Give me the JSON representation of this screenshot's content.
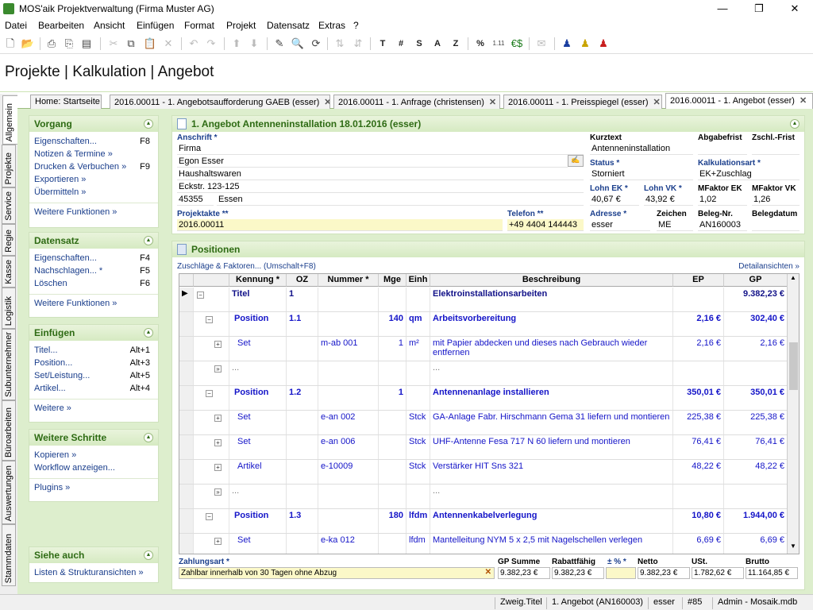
{
  "window": {
    "title": "MOS'aik Projektverwaltung (Firma Muster AG)"
  },
  "menu": [
    "Datei",
    "Bearbeiten",
    "Ansicht",
    "Einfügen",
    "Format",
    "Projekt",
    "Datensatz",
    "Extras",
    "?"
  ],
  "toolbar": {
    "text_buttons": [
      "T",
      "#",
      "S",
      "A",
      "Z",
      "%"
    ]
  },
  "breadcrumb": "Projekte | Kalkulation | Angebot",
  "doc_tabs": [
    {
      "label": "Home: Startseite"
    },
    {
      "label": "2016.00011 - 1. Angebotsaufforderung GAEB (esser)"
    },
    {
      "label": "2016.00011 - 1. Anfrage (christensen)"
    },
    {
      "label": "2016.00011 - 1. Preisspiegel (esser)"
    },
    {
      "label": "2016.00011 - 1. Angebot (esser)"
    }
  ],
  "side_tabs": [
    "Allgemein",
    "Projekte",
    "Service",
    "Regie",
    "Kasse",
    "Logistik",
    "Subunternehmer",
    "Büroarbeiten",
    "Auswertungen",
    "Stammdaten"
  ],
  "left": {
    "vorgang": {
      "title": "Vorgang",
      "items": [
        {
          "label": "Eigenschaften...",
          "key": "F8"
        },
        {
          "label": "Notizen & Termine »",
          "key": ""
        },
        {
          "label": "Drucken & Verbuchen »",
          "key": "F9"
        },
        {
          "label": "Exportieren »",
          "key": ""
        },
        {
          "label": "Übermitteln »",
          "key": ""
        }
      ],
      "more": "Weitere Funktionen »"
    },
    "datensatz": {
      "title": "Datensatz",
      "items": [
        {
          "label": "Eigenschaften...",
          "key": "F4"
        },
        {
          "label": "Nachschlagen... *",
          "key": "F5"
        },
        {
          "label": "Löschen",
          "key": "F6"
        }
      ],
      "more": "Weitere Funktionen »"
    },
    "einfuegen": {
      "title": "Einfügen",
      "items": [
        {
          "label": "Titel...",
          "key": "Alt+1"
        },
        {
          "label": "Position...",
          "key": "Alt+3"
        },
        {
          "label": "Set/Leistung...",
          "key": "Alt+5"
        },
        {
          "label": "Artikel...",
          "key": "Alt+4"
        }
      ],
      "more": "Weitere »"
    },
    "schritte": {
      "title": "Weitere Schritte",
      "items": [
        {
          "label": "Kopieren »",
          "key": ""
        },
        {
          "label": "Workflow anzeigen...",
          "key": ""
        }
      ],
      "more": "Plugins »"
    },
    "siehe": {
      "title": "Siehe auch",
      "items": [
        {
          "label": "Listen & Strukturansichten »",
          "key": ""
        }
      ]
    }
  },
  "header": {
    "title": "1. Angebot Antenneninstallation 18.01.2016 (esser)",
    "anschrift_label": "Anschrift *",
    "anschrift": [
      "Firma",
      "Egon Esser",
      "Haushaltswaren",
      "Eckstr. 123-125"
    ],
    "plz": "45355",
    "ort": "Essen",
    "projektakte_label": "Projektakte **",
    "projektakte": "2016.00011",
    "telefon_label": "Telefon **",
    "telefon": "+49 4404 144443",
    "kurztext_label": "Kurztext",
    "kurztext": "Antenneninstallation",
    "abgabefrist_label": "Abgabefrist",
    "zschl_label": "Zschl.-Frist",
    "status_label": "Status *",
    "status": "Storniert",
    "kalkart_label": "Kalkulationsart *",
    "kalkart": "EK+Zuschlag",
    "lohn_ek_label": "Lohn EK *",
    "lohn_ek": "40,67 €",
    "lohn_vk_label": "Lohn VK *",
    "lohn_vk": "43,92 €",
    "mf_ek_label": "MFaktor EK",
    "mf_ek": "1,02",
    "mf_vk_label": "MFaktor VK",
    "mf_vk": "1,26",
    "adresse_label": "Adresse *",
    "adresse": "esser",
    "zeichen_label": "Zeichen",
    "zeichen": "ME",
    "belegnr_label": "Beleg-Nr.",
    "belegnr": "AN160003",
    "belegdatum_label": "Belegdatum"
  },
  "positions": {
    "title": "Positionen",
    "zuschlaege": "Zuschläge & Faktoren... (Umschalt+F8)",
    "detail": "Detailansichten »",
    "columns": [
      "Kennung *",
      "OZ",
      "Nummer *",
      "Mge",
      "Einh",
      "Beschreibung",
      "EP",
      "GP"
    ],
    "rows": [
      {
        "kennung": "Titel",
        "oz": "1",
        "nummer": "",
        "mge": "",
        "einh": "",
        "beschreibung": "Elektroinstallationsarbeiten",
        "ep": "",
        "gp": "9.382,23 €",
        "lvl": 0,
        "bold": true
      },
      {
        "kennung": "Position",
        "oz": "1.1",
        "nummer": "",
        "mge": "140",
        "einh": "qm",
        "beschreibung": "Arbeitsvorbereitung",
        "ep": "2,16 €",
        "gp": "302,40 €",
        "lvl": 1,
        "bold": true
      },
      {
        "kennung": "Set",
        "oz": "",
        "nummer": "m-ab 001",
        "mge": "1",
        "einh": "m²",
        "beschreibung": "mit Papier abdecken und dieses nach Gebrauch wieder entfernen",
        "ep": "2,16 €",
        "gp": "2,16 €",
        "lvl": 2,
        "bold": false
      },
      {
        "kennung": "...",
        "oz": "",
        "nummer": "",
        "mge": "",
        "einh": "",
        "beschreibung": "...",
        "ep": "",
        "gp": "",
        "lvl": 2,
        "bold": false,
        "dots": true
      },
      {
        "kennung": "Position",
        "oz": "1.2",
        "nummer": "",
        "mge": "1",
        "einh": "",
        "beschreibung": "Antennenanlage installieren",
        "ep": "350,01 €",
        "gp": "350,01 €",
        "lvl": 1,
        "bold": true
      },
      {
        "kennung": "Set",
        "oz": "",
        "nummer": "e-an 002",
        "mge": "",
        "einh": "Stck",
        "beschreibung": "GA-Anlage Fabr. Hirschmann Gema 31 liefern und montieren",
        "ep": "225,38 €",
        "gp": "225,38 €",
        "lvl": 2,
        "bold": false
      },
      {
        "kennung": "Set",
        "oz": "",
        "nummer": "e-an 006",
        "mge": "",
        "einh": "Stck",
        "beschreibung": "UHF-Antenne Fesa 717 N 60 liefern und montieren",
        "ep": "76,41 €",
        "gp": "76,41 €",
        "lvl": 2,
        "bold": false
      },
      {
        "kennung": "Artikel",
        "oz": "",
        "nummer": "e-10009",
        "mge": "",
        "einh": "Stck",
        "beschreibung": "Verstärker HIT Sns 321",
        "ep": "48,22 €",
        "gp": "48,22 €",
        "lvl": 2,
        "bold": false
      },
      {
        "kennung": "...",
        "oz": "",
        "nummer": "",
        "mge": "",
        "einh": "",
        "beschreibung": "...",
        "ep": "",
        "gp": "",
        "lvl": 2,
        "bold": false,
        "dots": true
      },
      {
        "kennung": "Position",
        "oz": "1.3",
        "nummer": "",
        "mge": "180",
        "einh": "lfdm",
        "beschreibung": "Antennenkabelverlegung",
        "ep": "10,80 €",
        "gp": "1.944,00 €",
        "lvl": 1,
        "bold": true
      },
      {
        "kennung": "Set",
        "oz": "",
        "nummer": "e-ka 012",
        "mge": "",
        "einh": "lfdm",
        "beschreibung": "Mantelleitung NYM 5 x 2,5 mit Nagelschellen verlegen",
        "ep": "6,69 €",
        "gp": "6,69 €",
        "lvl": 2,
        "bold": false
      }
    ]
  },
  "summary": {
    "zahlungsart_label": "Zahlungsart *",
    "zahlungsart": "Zahlbar innerhalb von 30 Tagen ohne Abzug",
    "gp_summe_label": "GP Summe",
    "gp_summe": "9.382,23 €",
    "rabatt_label": "Rabattfähig",
    "rabatt": "9.382,23 €",
    "pct_label": "± % *",
    "pct": "",
    "netto_label": "Netto",
    "netto": "9.382,23 €",
    "ust_label": "USt.",
    "ust": "1.782,62 €",
    "brutto_label": "Brutto",
    "brutto": "11.164,85 €"
  },
  "status": [
    "Zweig.Titel",
    "1. Angebot (AN160003)",
    "esser",
    "#85",
    "Admin - Mosaik.mdb"
  ]
}
